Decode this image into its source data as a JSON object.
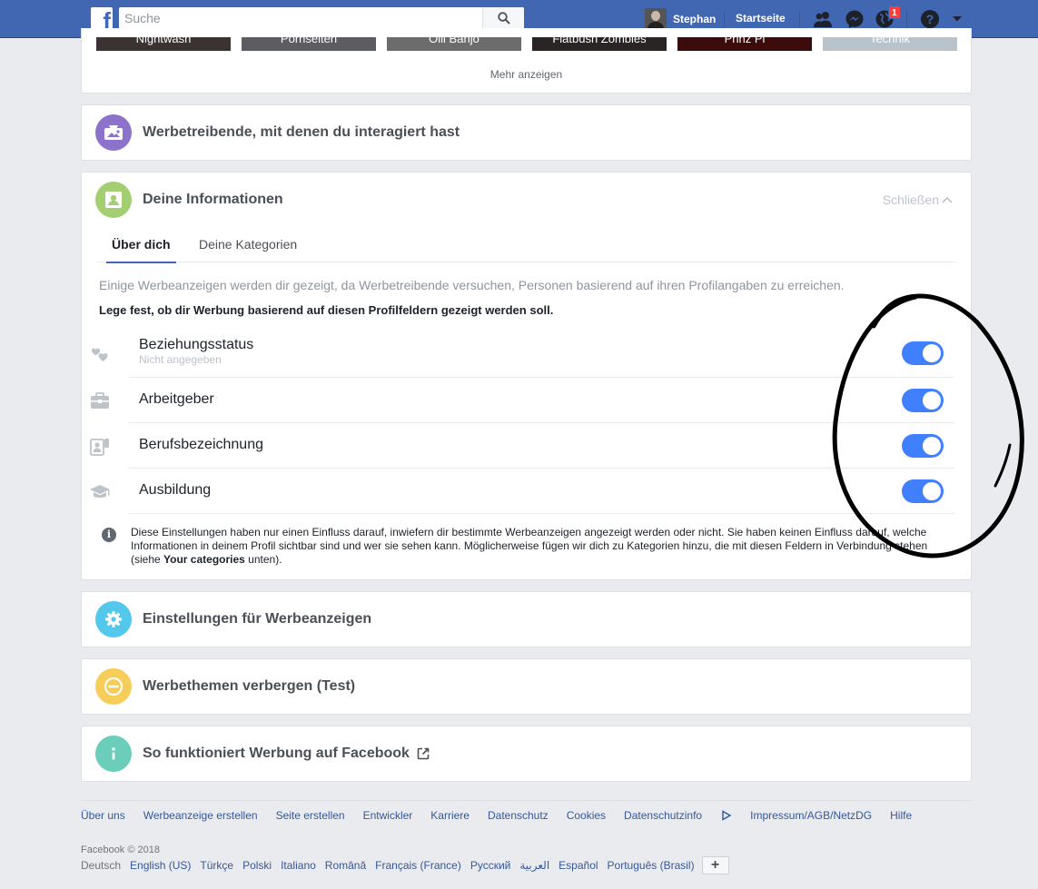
{
  "topbar": {
    "search_placeholder": "Suche",
    "user_name": "Stephan",
    "home_label": "Startseite",
    "notification_count": "1"
  },
  "top_card": {
    "thumbs": [
      "Nightwash",
      "Pornseiten",
      "Olli Banjo",
      "Flatbush Zombies",
      "Prinz Pi",
      "Technik"
    ],
    "more_link": "Mehr anzeigen"
  },
  "advertisers": {
    "title": "Werbetreibende, mit denen du interagiert hast"
  },
  "your_info": {
    "title": "Deine Informationen",
    "close_label": "Schließen",
    "tabs": [
      "Über dich",
      "Deine Kategorien"
    ],
    "intro": "Einige Werbeanzeigen werden dir gezeigt, da Werbetreibende versuchen, Personen basierend auf ihren Profilangaben zu erreichen.",
    "intro_bold": "Lege fest, ob dir Werbung basierend auf diesen Profilfeldern gezeigt werden soll.",
    "rows": [
      {
        "label": "Beziehungsstatus",
        "sub": "Nicht angegeben",
        "icon": "hearts-icon",
        "enabled": true
      },
      {
        "label": "Arbeitgeber",
        "sub": "",
        "icon": "briefcase-icon",
        "enabled": true
      },
      {
        "label": "Berufsbezeichnung",
        "sub": "",
        "icon": "id-badge-icon",
        "enabled": true
      },
      {
        "label": "Ausbildung",
        "sub": "",
        "icon": "graduation-cap-icon",
        "enabled": true
      }
    ],
    "note_text": "Diese Einstellungen haben nur einen Einfluss darauf, inwiefern dir bestimmte Werbeanzeigen angezeigt werden oder nicht. Sie haben keinen Einfluss darauf, welche Informationen in deinem Profil sichtbar sind und wer sie sehen kann. Möglicherweise fügen wir dich zu Kategorien hinzu, die mit diesen Feldern in Verbindung stehen (siehe ",
    "note_bold": "Your categories",
    "note_end": " unten)."
  },
  "ad_settings": {
    "title": "Einstellungen für Werbeanzeigen"
  },
  "hide_topics": {
    "title": "Werbethemen verbergen (Test)"
  },
  "how_ads_work": {
    "title": "So funktioniert Werbung auf Facebook"
  },
  "colors": {
    "brand": "#4267b2",
    "purple": "#8c72cb",
    "green": "#a3ce71",
    "blue": "#54c7ec",
    "yellow": "#f7cd59",
    "teal": "#6bcebb",
    "toggle_on": "#4080ff"
  },
  "footer": {
    "links": [
      "Über uns",
      "Werbeanzeige erstellen",
      "Seite erstellen",
      "Entwickler",
      "Karriere",
      "Datenschutz",
      "Cookies",
      "Datenschutzinfo",
      "Impressum/AGB/NetzDG",
      "Hilfe"
    ],
    "copyright": "Facebook © 2018",
    "current_language": "Deutsch",
    "languages": [
      "English (US)",
      "Türkçe",
      "Polski",
      "Italiano",
      "Română",
      "Français (France)",
      "Русский",
      "العربية",
      "Español",
      "Português (Brasil)"
    ],
    "more_languages": "+"
  }
}
